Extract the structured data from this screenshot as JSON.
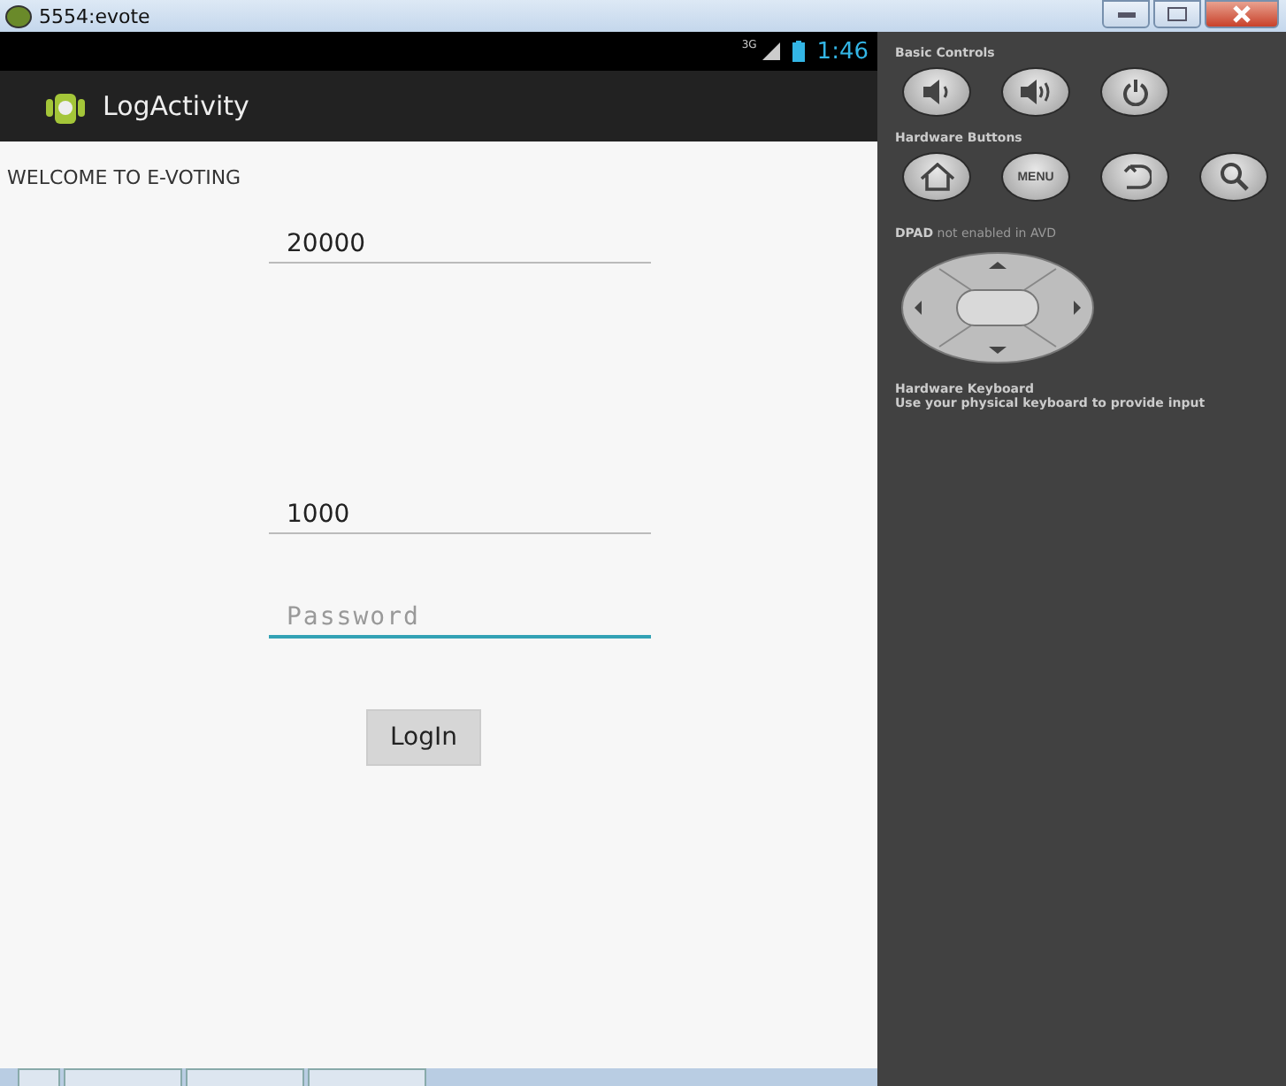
{
  "window": {
    "title": "5554:evote"
  },
  "status_bar": {
    "network": "3G",
    "time": "1:46"
  },
  "action_bar": {
    "title": "LogActivity"
  },
  "content": {
    "heading": "WELCOME TO E-VOTING",
    "fields": [
      {
        "value": "20000",
        "focused": false
      },
      {
        "value": "1000",
        "focused": false
      },
      {
        "placeholder": "Password",
        "focused": true
      }
    ],
    "button": "LogIn"
  },
  "controls": {
    "basic_title": "Basic Controls",
    "basic": [
      {
        "kind": "volume-down"
      },
      {
        "kind": "volume-up"
      },
      {
        "kind": "power"
      }
    ],
    "hardware_title": "Hardware Buttons",
    "hardware": [
      {
        "kind": "home"
      },
      {
        "kind": "menu",
        "label": "MENU"
      },
      {
        "kind": "back"
      },
      {
        "kind": "search"
      }
    ],
    "dpad_note": "**DPAD** not enabled in AVD",
    "keyboard_title": "Hardware Keyboard",
    "keyboard_note": "Use your physical keyboard to provide input"
  }
}
